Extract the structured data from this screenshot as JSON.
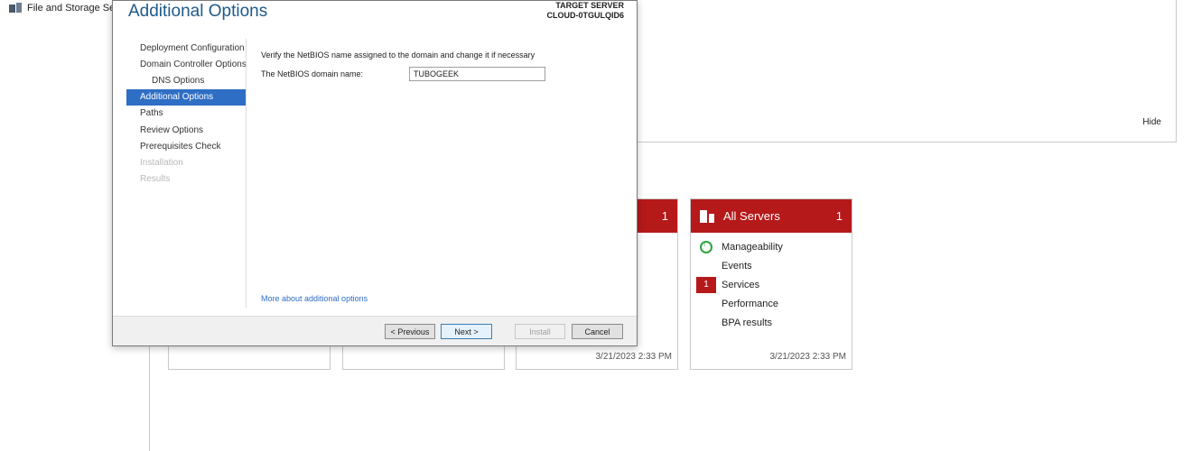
{
  "left_nav": {
    "item_label": "File and Storage Ser"
  },
  "welcome": {
    "hide_label": "Hide"
  },
  "tiles": [
    {
      "count": "1",
      "time": "3/21/2023 2:33 PM"
    },
    {
      "title": "All Servers",
      "count": "1",
      "rows": [
        "Manageability",
        "Events",
        "Services",
        "Performance",
        "BPA results"
      ],
      "services_badge": "1",
      "time": "3/21/2023 2:33 PM"
    }
  ],
  "dialog": {
    "title": "Additional Options",
    "target_label": "TARGET SERVER",
    "target_name": "CLOUD-0TGULQID6",
    "steps": [
      "Deployment Configuration",
      "Domain Controller Options",
      "DNS Options",
      "Additional Options",
      "Paths",
      "Review Options",
      "Prerequisites Check",
      "Installation",
      "Results"
    ],
    "instruction": "Verify the NetBIOS name assigned to the domain and change it if necessary",
    "netbios_label": "The NetBIOS domain name:",
    "netbios_value": "TUBOGEEK",
    "more_link": "More about additional options",
    "buttons": {
      "previous": "< Previous",
      "next": "Next >",
      "install": "Install",
      "cancel": "Cancel"
    }
  }
}
